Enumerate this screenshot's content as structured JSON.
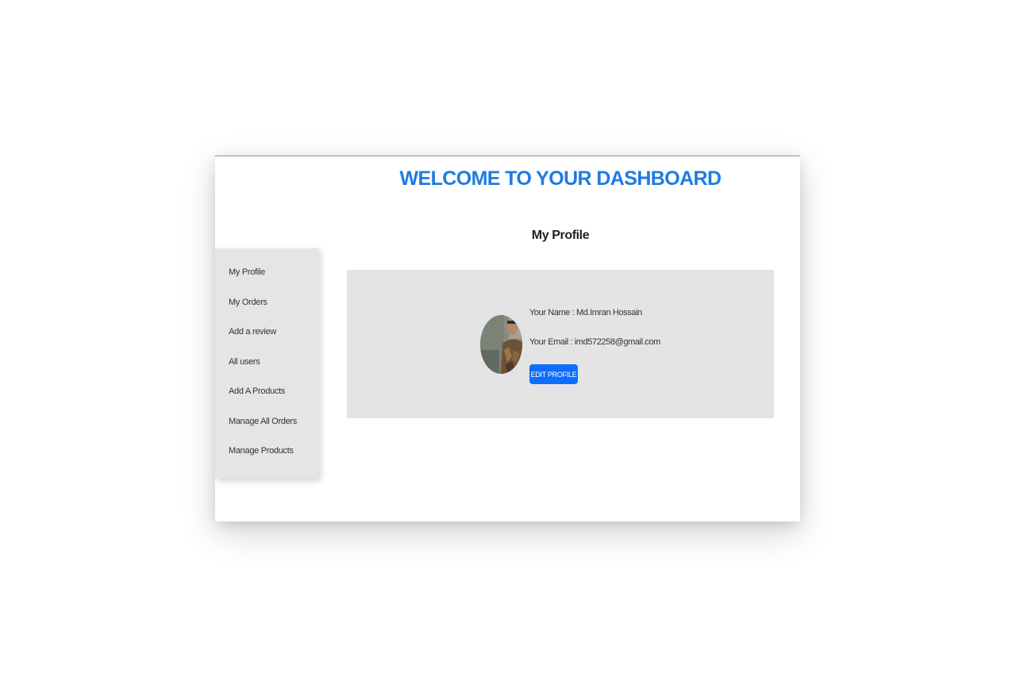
{
  "header": {
    "title": "WELCOME TO YOUR DASHBOARD"
  },
  "sidebar": {
    "items": [
      {
        "label": "My Profile"
      },
      {
        "label": "My Orders"
      },
      {
        "label": "Add a review"
      },
      {
        "label": "All users"
      },
      {
        "label": "Add A Products"
      },
      {
        "label": "Manage All Orders"
      },
      {
        "label": "Manage Products"
      }
    ]
  },
  "main": {
    "section_title": "My Profile",
    "profile": {
      "name_line": "Your Name : Md.Imran Hossain",
      "email_line": "Your Email : imd572258@gmail.com",
      "edit_label": "EDIT PROFILE"
    }
  },
  "colors": {
    "accent": "#1e7be0",
    "button": "#0d6efd",
    "panel": "#e4e4e4"
  }
}
